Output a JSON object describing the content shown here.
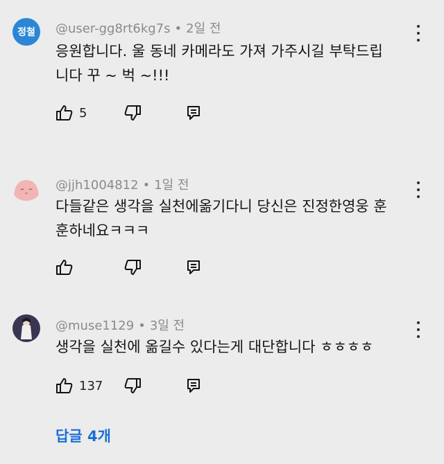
{
  "comments": [
    {
      "avatar_text": "정철",
      "author": "@user-gg8rt6kg7s",
      "time": "2일 전",
      "line1": "응원합니다. 울 동네 카메라도 가져 가주시길 부탁드립",
      "line2": "니다 꾸 ~ 벅 ~!!!",
      "likes": "5"
    },
    {
      "author": "@jjh1004812",
      "time": "1일 전",
      "line1": "다들같은 생각을 실천에옮기다니 당신은 진정한영웅 훈",
      "line2": "훈하네요ㅋㅋㅋ",
      "likes": ""
    },
    {
      "author": "@muse1129",
      "time": "3일 전",
      "line1": "생각을 실천에 옮길수 있다는게 대단합니다 ㅎㅎㅎㅎ",
      "likes": "137"
    }
  ],
  "replies_label": "답글 4개",
  "colors": {
    "accent": "#1a6ed8",
    "background": "#ececec",
    "avatar_blue": "#2c86d6"
  },
  "icons": [
    "thumb-up-icon",
    "thumb-down-icon",
    "reply-icon",
    "more-vert-icon"
  ]
}
